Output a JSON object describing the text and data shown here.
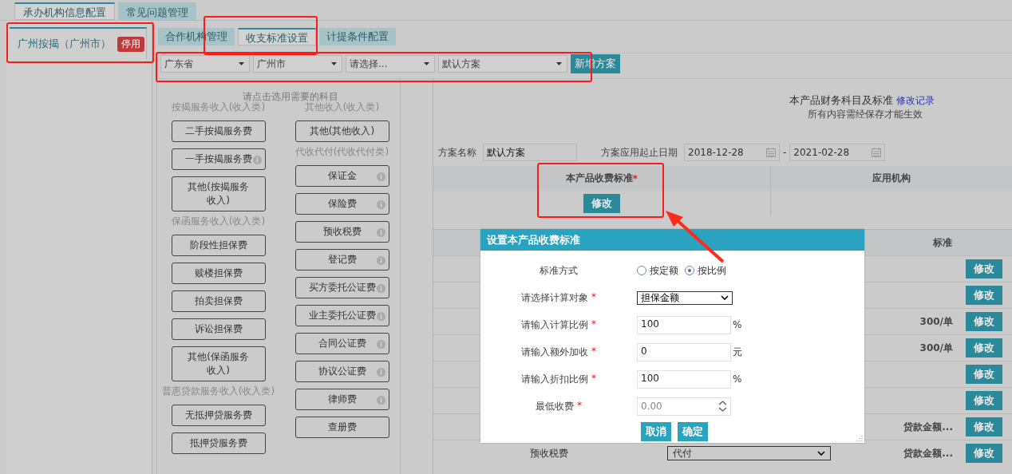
{
  "top_tabs": [
    {
      "label": "承办机构信息配置",
      "selected": true
    },
    {
      "label": "常见问题管理",
      "selected": false
    }
  ],
  "org": {
    "name": "广州按揭（广州市）",
    "badge": "停用"
  },
  "sub_tabs": [
    {
      "label": "合作机构管理",
      "selected": false
    },
    {
      "label": "收支标准设置",
      "selected": true
    },
    {
      "label": "计提条件配置",
      "selected": false
    }
  ],
  "filters": [
    {
      "value": "广东省"
    },
    {
      "value": "广州市"
    },
    {
      "value": "请选择..."
    },
    {
      "value": "默认方案"
    }
  ],
  "add_button": "新增方案",
  "subjects": {
    "hint": "请点击选用需要的科目",
    "columns": [
      [
        {
          "heading": "按揭服务收入(收入类)",
          "items": [
            {
              "label": "二手按揭服务费",
              "info": false
            },
            {
              "label": "一手按揭服务费",
              "info": true
            },
            {
              "label": "其他(按揭服务收入)",
              "info": false
            }
          ]
        },
        {
          "heading": "保函服务收入(收入类)",
          "items": [
            {
              "label": "阶段性担保费",
              "info": false
            },
            {
              "label": "赎楼担保费",
              "info": false
            },
            {
              "label": "拍卖担保费",
              "info": false
            },
            {
              "label": "诉讼担保费",
              "info": false
            },
            {
              "label": "其他(保函服务收入)",
              "info": false
            }
          ]
        },
        {
          "heading": "普惠贷款服务收入(收入类)",
          "items": [
            {
              "label": "无抵押贷服务费",
              "info": false
            },
            {
              "label": "抵押贷服务费",
              "info": false
            }
          ]
        }
      ],
      [
        {
          "heading": "其他收入(收入类)",
          "items": [
            {
              "label": "其他(其他收入)",
              "info": false
            }
          ]
        },
        {
          "heading": "代收代付(代收代付类)",
          "items": [
            {
              "label": "保证金",
              "info": true
            },
            {
              "label": "保险费",
              "info": true
            },
            {
              "label": "预收税费",
              "info": true
            },
            {
              "label": "登记费",
              "info": true
            },
            {
              "label": "买方委托公证费",
              "info": true
            },
            {
              "label": "业主委托公证费",
              "info": true
            },
            {
              "label": "合同公证费",
              "info": true
            },
            {
              "label": "协议公证费",
              "info": true
            },
            {
              "label": "律师费",
              "info": true
            },
            {
              "label": "查册费",
              "info": false
            }
          ]
        }
      ]
    ]
  },
  "panel": {
    "title": "本产品财务科目及标准",
    "history_link": "修改记录",
    "note": "所有内容需经保存才能生效",
    "plan_name_label": "方案名称",
    "plan_name": "默认方案",
    "date_label": "方案应用起止日期",
    "start_date": "2018-12-28",
    "date_sep": "-",
    "end_date": "2021-02-28"
  },
  "standard_table": {
    "columns": [
      "本产品收费标准",
      "应用机构"
    ],
    "required_mark": "*",
    "edit_button": "修改"
  },
  "items_table": {
    "header": "标准",
    "rows": [
      {
        "button": "修改"
      },
      {
        "button": "修改"
      },
      {
        "standard": "300/单",
        "button": "修改"
      },
      {
        "standard": "300/单",
        "button": "修改"
      },
      {
        "button": "修改"
      },
      {
        "button": "修改"
      },
      {
        "standard": "贷款金额...",
        "button": "修改"
      },
      {
        "label": "预收税费",
        "select": "代付",
        "standard": "贷款金额...",
        "button": "修改"
      }
    ]
  },
  "dialog": {
    "title": "设置本产品收费标准",
    "fields": [
      {
        "kind": "radio",
        "label": "标准方式",
        "options": [
          {
            "label": "按定额",
            "selected": false
          },
          {
            "label": "按比例",
            "selected": true
          }
        ]
      },
      {
        "kind": "select",
        "label": "请选择计算对象",
        "required": true,
        "value": "担保金额"
      },
      {
        "kind": "input",
        "label": "请输入计算比例",
        "required": true,
        "value": "100",
        "unit": "%"
      },
      {
        "kind": "input",
        "label": "请输入额外加收",
        "required": true,
        "value": "0",
        "unit": "元"
      },
      {
        "kind": "input",
        "label": "请输入折扣比例",
        "required": true,
        "value": "100",
        "unit": "%"
      },
      {
        "kind": "number",
        "label": "最低收费",
        "required": true,
        "placeholder": "0.00"
      }
    ],
    "buttons": [
      "取消",
      "确定"
    ]
  }
}
